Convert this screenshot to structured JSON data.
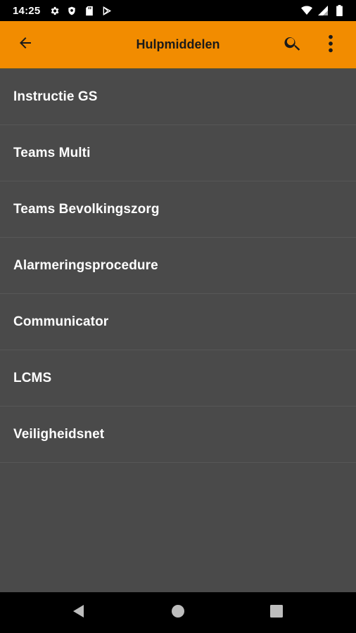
{
  "status_bar": {
    "time": "14:25",
    "left_icons": [
      "gear-icon",
      "shield-icon",
      "sd-card-icon",
      "play-store-icon"
    ],
    "right_icons": [
      "wifi-icon",
      "cell-signal-icon",
      "battery-icon"
    ]
  },
  "app_bar": {
    "title": "Hulpmiddelen",
    "background_color": "#f28c00",
    "icons": [
      "back-arrow-icon",
      "search-icon",
      "more-vert-icon"
    ]
  },
  "list": {
    "items": [
      {
        "label": "Instructie GS"
      },
      {
        "label": "Teams Multi"
      },
      {
        "label": "Teams Bevolkingszorg"
      },
      {
        "label": "Alarmeringsprocedure"
      },
      {
        "label": "Communicator"
      },
      {
        "label": "LCMS"
      },
      {
        "label": "Veiligheidsnet"
      }
    ]
  },
  "nav_bar": {
    "icons": [
      "back-triangle-icon",
      "home-circle-icon",
      "recents-square-icon"
    ]
  }
}
